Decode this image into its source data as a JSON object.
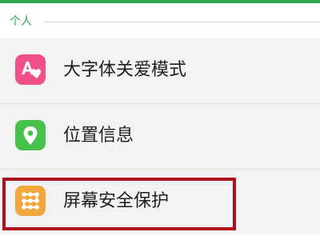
{
  "section": {
    "title": "个人"
  },
  "items": [
    {
      "label": "大字体关爱模式",
      "icon": "large-font-care-icon",
      "color": "#f0508a"
    },
    {
      "label": "位置信息",
      "icon": "location-pin-icon",
      "color": "#46c14a"
    },
    {
      "label": "屏幕安全保护",
      "icon": "screen-pattern-lock-icon",
      "color": "#f2a63e"
    }
  ],
  "colors": {
    "accent": "#2ea84a",
    "highlight": "#b0121d"
  }
}
